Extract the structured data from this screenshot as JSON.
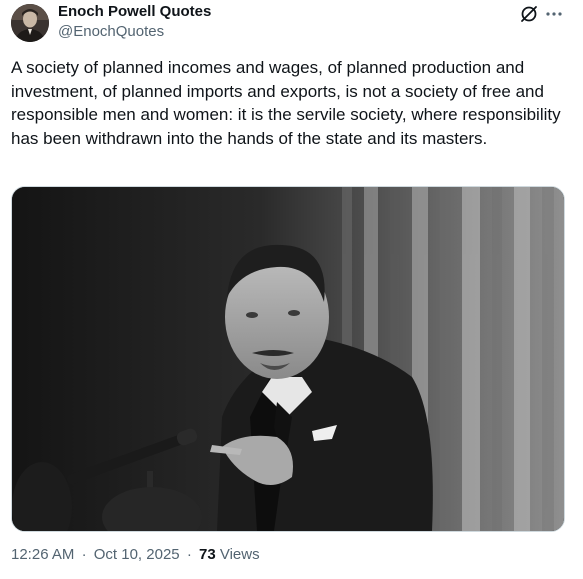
{
  "author": {
    "display_name": "Enoch Powell Quotes",
    "handle": "@EnochQuotes"
  },
  "icons": {
    "avatar": "portrait-photo",
    "grok": "grok-slash-circle-icon",
    "more": "more-horizontal-icon"
  },
  "tweet": {
    "text": "A society of planned incomes and wages, of planned production and investment, of planned imports and exports, is not a society of free and responsible men and women: it is the servile society, where responsibility has been withdrawn into the hands of the state and its masters."
  },
  "media": {
    "description_icon": "photo",
    "style": "black-and-white photograph of a man speaking at a microphone"
  },
  "meta": {
    "time": "12:26 AM",
    "separator1": "·",
    "date": "Oct 10, 2025",
    "separator2": "·",
    "views_count": "73",
    "views_label": "Views"
  },
  "colors": {
    "text_primary": "#0f1419",
    "text_secondary": "#536471",
    "border": "#cfd9de"
  }
}
